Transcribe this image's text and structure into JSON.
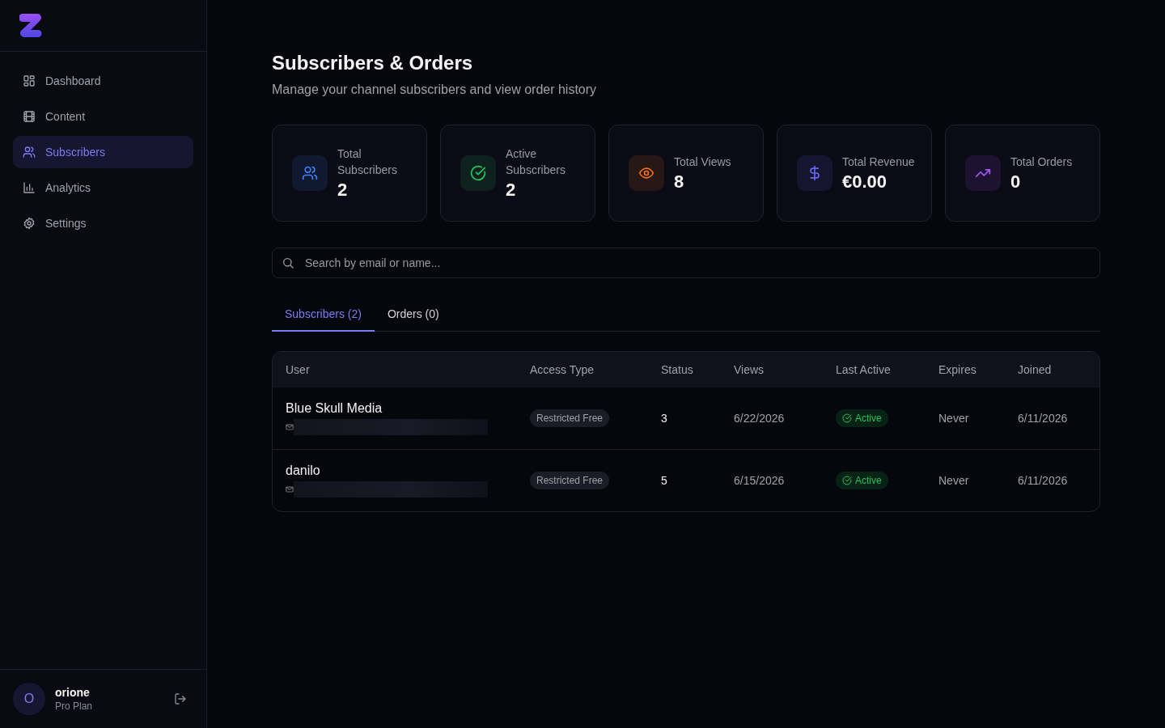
{
  "sidebar": {
    "items": [
      {
        "label": "Dashboard",
        "kind": "grid",
        "selected": false
      },
      {
        "label": "Content",
        "kind": "film",
        "selected": false
      },
      {
        "label": "Subscribers",
        "kind": "users",
        "selected": true
      },
      {
        "label": "Analytics",
        "kind": "chart",
        "selected": false
      },
      {
        "label": "Settings",
        "kind": "gear",
        "selected": false
      }
    ],
    "user": {
      "initial": "O",
      "name": "orione",
      "plan": "Pro Plan"
    }
  },
  "header": {
    "title": "Subscribers & Orders",
    "subtitle": "Manage your channel subscribers and view order history"
  },
  "stats": [
    {
      "label": "Total Subscribers",
      "value": "2",
      "kind": "users",
      "color": "#3b82f6"
    },
    {
      "label": "Active Subscribers",
      "value": "2",
      "kind": "check",
      "color": "#22c55e"
    },
    {
      "label": "Total Views",
      "value": "8",
      "kind": "eye",
      "color": "#f97316"
    },
    {
      "label": "Total Revenue",
      "value": "€0.00",
      "kind": "dollar",
      "color": "#6366f1"
    },
    {
      "label": "Total Orders",
      "value": "0",
      "kind": "trend",
      "color": "#a855f7"
    }
  ],
  "search": {
    "placeholder": "Search by email or name..."
  },
  "tabs": [
    {
      "label": "Subscribers (2)",
      "selected": true
    },
    {
      "label": "Orders (0)",
      "selected": false
    }
  ],
  "table": {
    "columns": [
      "User",
      "Access Type",
      "Status",
      "Views",
      "Last Active",
      "Expires",
      "Joined"
    ],
    "rows": [
      {
        "name": "Blue Skull Media",
        "access": "Restricted Free",
        "status": "3",
        "views": "6/22/2026",
        "last_active": "Active",
        "expires": "Never",
        "joined": "6/11/2026"
      },
      {
        "name": "danilo",
        "access": "Restricted Free",
        "status": "5",
        "views": "6/15/2026",
        "last_active": "Active",
        "expires": "Never",
        "joined": "6/11/2026"
      }
    ]
  }
}
